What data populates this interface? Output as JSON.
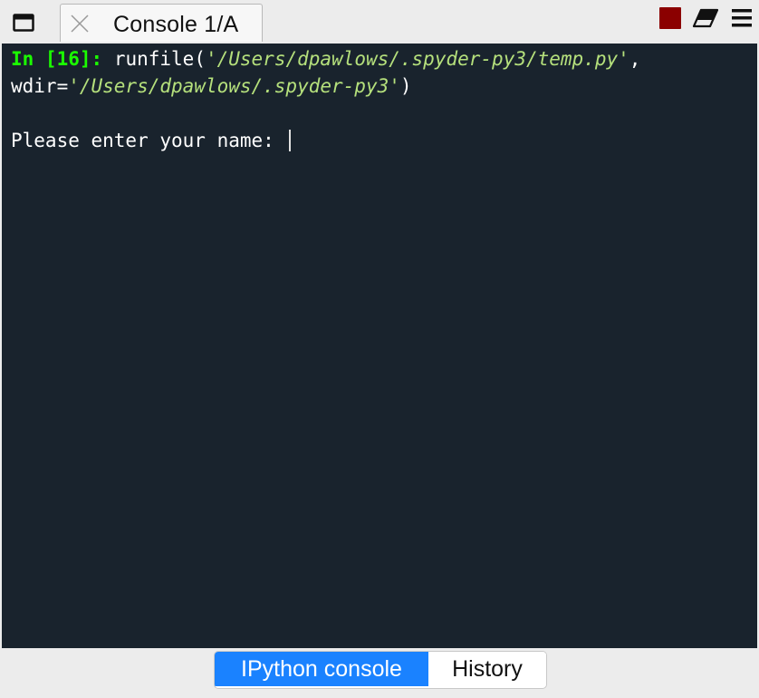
{
  "tabbar": {
    "undock_icon": "window-undock-icon",
    "tab": {
      "label": "Console 1/A",
      "close_icon": "close-icon"
    },
    "stop_icon": "stop-square-icon",
    "stop_color": "#8b0000",
    "clear_icon": "eraser-icon",
    "menu_icon": "hamburger-menu-icon"
  },
  "console": {
    "background": "#19232d",
    "prompt_label": "In [",
    "prompt_number": "16",
    "prompt_end": "]:",
    "command_call": " runfile(",
    "arg1": "'/Users/dpawlows/.spyder-py3/temp.py'",
    "comma": ",",
    "wdir_label": "wdir=",
    "arg2": "'/Users/dpawlows/.spyder-py3'",
    "close_paren": ")",
    "input_prompt": "Please enter your name: "
  },
  "bottom_tabs": [
    {
      "label": "IPython console",
      "active": true
    },
    {
      "label": "History",
      "active": false
    }
  ]
}
